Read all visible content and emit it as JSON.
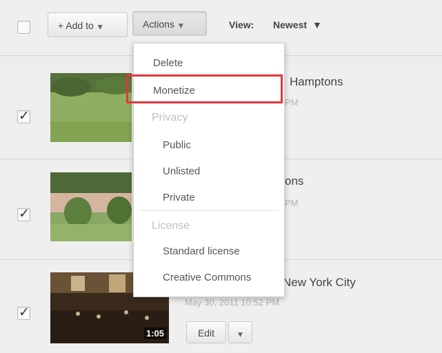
{
  "toolbar": {
    "add_to_label": "+ Add to",
    "actions_label": "Actions",
    "view_label": "View:",
    "view_value": "Newest"
  },
  "menu": {
    "items": {
      "delete": "Delete",
      "monetize": "Monetize",
      "privacy_header": "Privacy",
      "public": "Public",
      "unlisted": "Unlisted",
      "private": "Private",
      "license_header": "License",
      "standard_license": "Standard license",
      "creative_commons": "Creative Commons"
    }
  },
  "videos": [
    {
      "title_visible": "Hamptons",
      "date_visible": "PM",
      "checked": true
    },
    {
      "title_visible": "ons",
      "date_visible": "PM",
      "checked": true
    },
    {
      "title_visible": "New York City",
      "date_visible": "May 30, 2011 10:52 PM",
      "duration": "1:05",
      "checked": true,
      "edit_label": "Edit"
    }
  ],
  "colors": {
    "highlight": "#e0363b",
    "background": "#ececec"
  }
}
